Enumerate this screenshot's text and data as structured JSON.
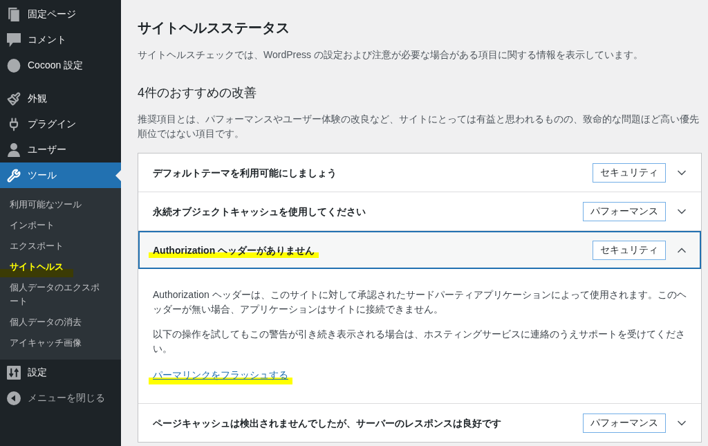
{
  "sidebar": {
    "sections": [
      {
        "items": [
          {
            "label": "固定ページ",
            "selected": false
          },
          {
            "label": "コメント",
            "selected": false
          },
          {
            "label": "Cocoon 設定",
            "selected": false
          }
        ]
      },
      {
        "items": [
          {
            "label": "外観",
            "selected": false
          },
          {
            "label": "プラグイン",
            "selected": false
          },
          {
            "label": "ユーザー",
            "selected": false
          },
          {
            "label": "ツール",
            "selected": true,
            "children": [
              {
                "label": "利用可能なツール",
                "selected": false,
                "highlighted": false
              },
              {
                "label": "インポート",
                "selected": false,
                "highlighted": false
              },
              {
                "label": "エクスポート",
                "selected": false,
                "highlighted": false
              },
              {
                "label": "サイトヘルス",
                "selected": true,
                "highlighted": true
              },
              {
                "label": "個人データのエクスポート",
                "selected": false,
                "highlighted": false
              },
              {
                "label": "個人データの消去",
                "selected": false,
                "highlighted": false
              },
              {
                "label": "アイキャッチ画像",
                "selected": false,
                "highlighted": false
              }
            ]
          },
          {
            "label": "設定",
            "selected": false
          }
        ]
      }
    ],
    "collapse_button": {
      "label": "メニューを閉じる"
    }
  },
  "main": {
    "title": "サイトヘルスステータス",
    "description": "サイトヘルスチェックでは、WordPress の設定および注意が必要な場合がある項目に関する情報を表示しています。",
    "recommendations": {
      "heading": "4件のおすすめの改善",
      "description": "推奨項目とは、パフォーマンスやユーザー体験の改良など、サイトにとっては有益と思われるものの、致命的な問題ほど高い優先順位ではない項目です。",
      "items": [
        {
          "title": "デフォルトテーマを利用可能にしましょう",
          "badge": "セキュリティ",
          "expanded": false,
          "highlighted": false
        },
        {
          "title": "永続オブジェクトキャッシュを使用してください",
          "badge": "パフォーマンス",
          "expanded": false,
          "highlighted": false
        },
        {
          "title": "Authorization ヘッダーがありません",
          "badge": "セキュリティ",
          "expanded": true,
          "highlighted": true,
          "details": [
            "Authorization ヘッダーは、このサイトに対して承認されたサードパーティアプリケーションによって使用されます。このヘッダーが無い場合、アプリケーションはサイトに接続できません。",
            "以下の操作を試してもこの警告が引き続き表示される場合は、ホスティングサービスに連絡のうえサポートを受けてください。"
          ],
          "link": {
            "label": "パーマリンクをフラッシュする",
            "highlighted": true
          }
        },
        {
          "title": "ページキャッシュは検出されませんでしたが、サーバーのレスポンスは良好です",
          "badge": "パフォーマンス",
          "expanded": false,
          "highlighted": false
        }
      ]
    }
  }
}
